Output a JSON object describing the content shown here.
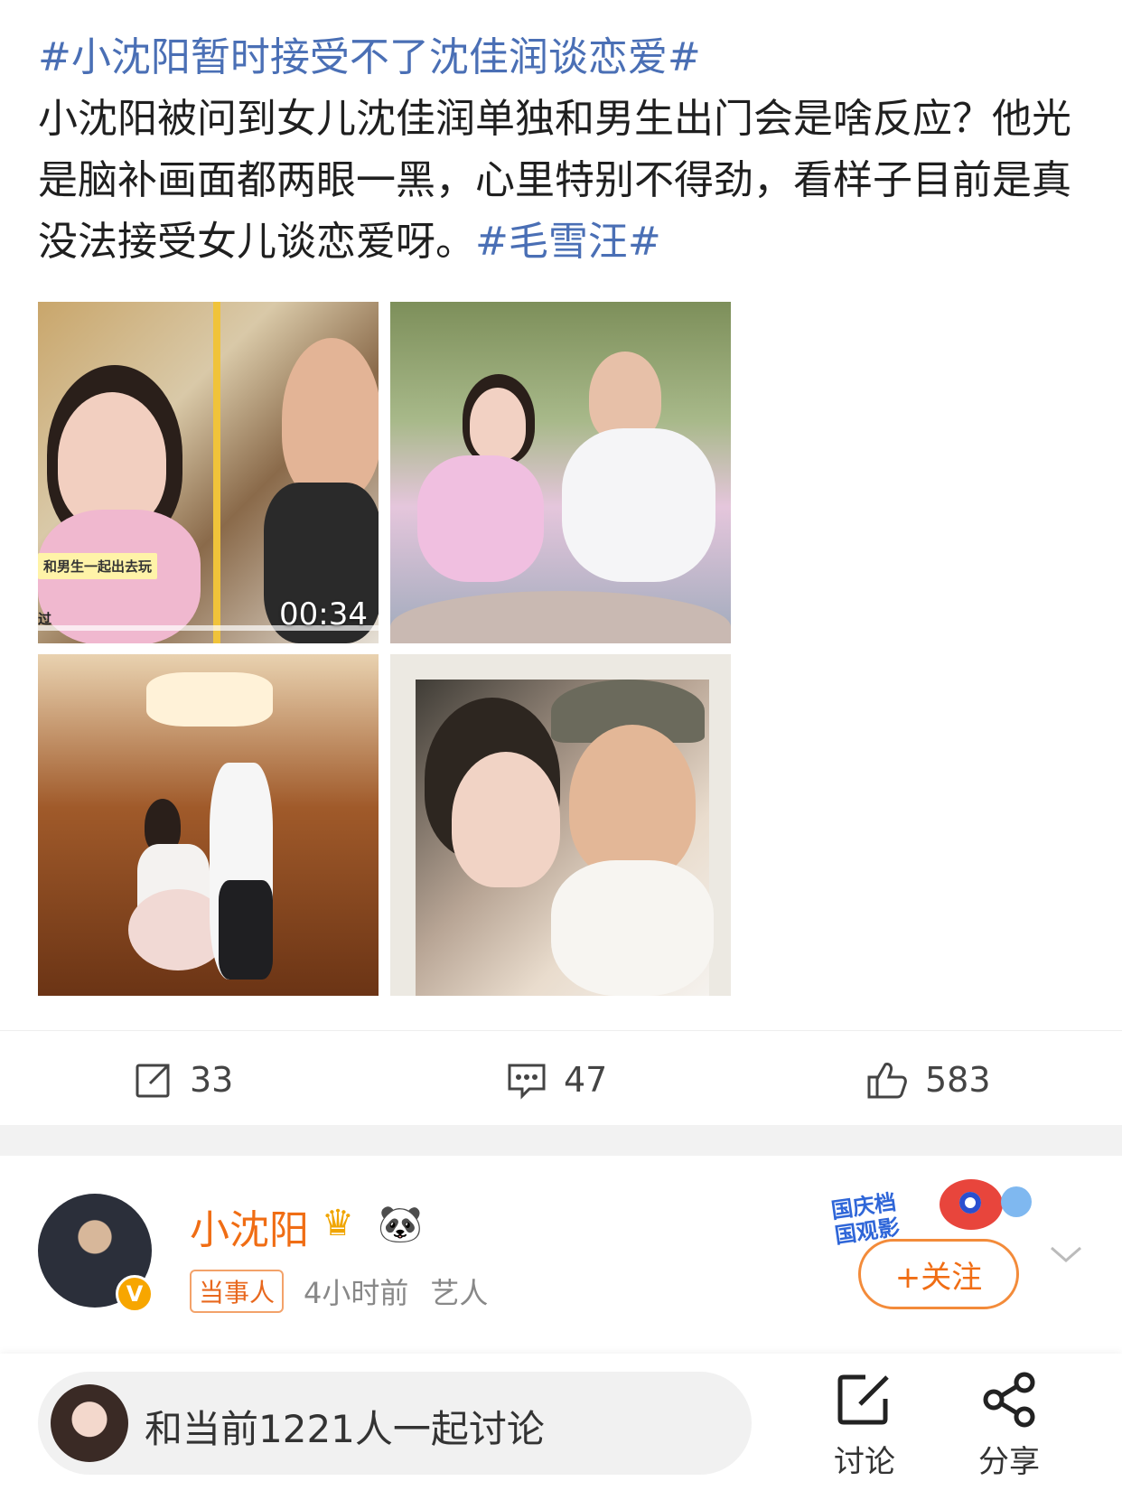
{
  "post": {
    "topic1": "#小沈阳暂时接受不了沈佳润谈恋爱#",
    "body": "小沈阳被问到女儿沈佳润单独和男生出门会是啥反应？他光是脑补画面都两眼一黑，心里特别不得劲，看样子目前是真没法接受女儿谈恋爱呀。",
    "topic2": "#毛雪汪#"
  },
  "media": {
    "video_caption": "和男生一起出去玩",
    "video_caption2": "过",
    "video_duration": "00:34"
  },
  "actions": {
    "repost_count": "33",
    "comment_count": "47",
    "like_count": "583"
  },
  "author": {
    "name": "小沈阳",
    "tag": "当事人",
    "time": "4小时前",
    "role": "艺人",
    "verified_mark": "V",
    "follow_label": "+关注",
    "promo_text_line1": "国庆档",
    "promo_text_line2": "国观影"
  },
  "bottom": {
    "discuss_text": "和当前1221人一起讨论",
    "tool_discuss": "讨论",
    "tool_share": "分享"
  },
  "colors": {
    "topic": "#4a6fb5",
    "author_name": "#f06d14",
    "follow_border": "#f38b3a"
  }
}
